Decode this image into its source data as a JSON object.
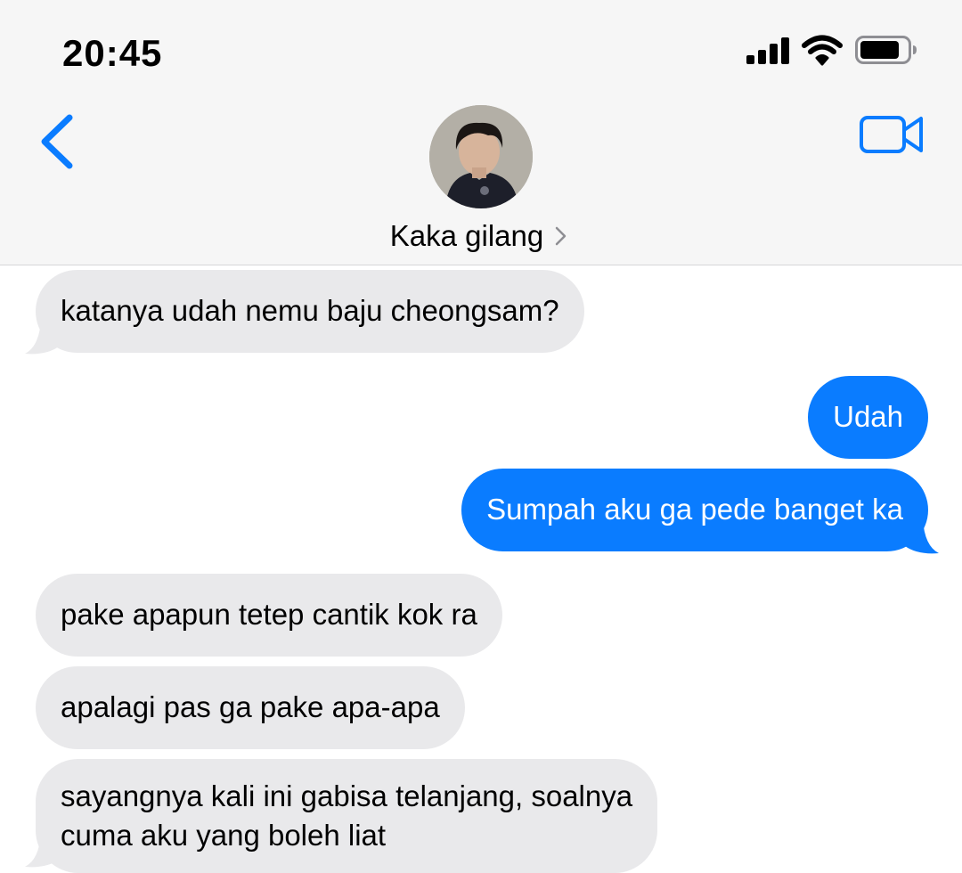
{
  "status_bar": {
    "time": "20:45"
  },
  "header": {
    "contact_name": "Kaka gilang"
  },
  "colors": {
    "outgoing_bubble": "#0a7cff",
    "incoming_bubble": "#e9e9eb",
    "accent": "#0a7cff"
  },
  "messages": [
    {
      "direction": "incoming",
      "text": "katanya udah nemu baju cheongsam?"
    },
    {
      "direction": "outgoing",
      "text": "Udah"
    },
    {
      "direction": "outgoing",
      "text": "Sumpah aku ga pede banget ka"
    },
    {
      "direction": "incoming",
      "text": "pake apapun tetep cantik kok ra"
    },
    {
      "direction": "incoming",
      "text": "apalagi pas ga pake apa-apa"
    },
    {
      "direction": "incoming",
      "lines": [
        "sayangnya kali ini gabisa telanjang, soalnya",
        "cuma aku yang boleh liat"
      ]
    }
  ]
}
